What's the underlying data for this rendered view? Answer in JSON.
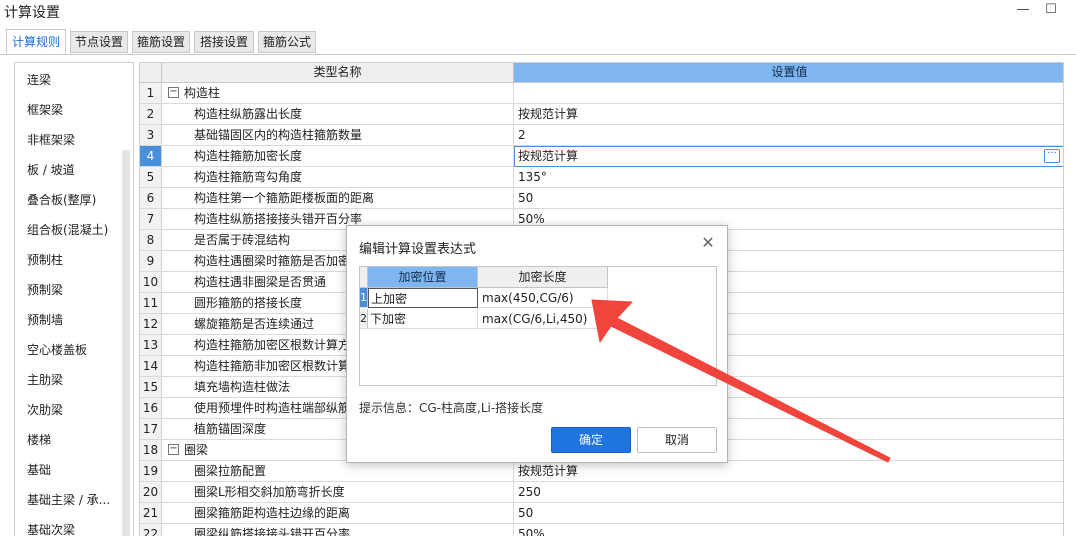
{
  "window": {
    "title": "计算设置",
    "minimize": "—",
    "maximize": "☐"
  },
  "tabs": [
    "计算规则",
    "节点设置",
    "箍筋设置",
    "搭接设置",
    "箍筋公式"
  ],
  "sidebar": {
    "items": [
      "连梁",
      "框架梁",
      "非框架梁",
      "板 / 坡道",
      "叠合板(整厚)",
      "组合板(混凝土)",
      "预制柱",
      "预制梁",
      "预制墙",
      "空心楼盖板",
      "主肋梁",
      "次肋梁",
      "楼梯",
      "基础",
      "基础主梁 / 承...",
      "基础次梁"
    ]
  },
  "grid": {
    "header_name": "类型名称",
    "header_value": "设置值",
    "expander_symbol": "−",
    "ellipsis": "···",
    "rows": [
      {
        "num": "1",
        "name": "构造柱",
        "value": "",
        "group": true
      },
      {
        "num": "2",
        "name": "构造柱纵筋露出长度",
        "value": "按规范计算"
      },
      {
        "num": "3",
        "name": "基础锚固区内的构造柱箍筋数量",
        "value": "2"
      },
      {
        "num": "4",
        "name": "构造柱箍筋加密长度",
        "value": "按规范计算",
        "selected": true
      },
      {
        "num": "5",
        "name": "构造柱箍筋弯勾角度",
        "value": "135°"
      },
      {
        "num": "6",
        "name": "构造柱第一个箍筋距楼板面的距离",
        "value": "50"
      },
      {
        "num": "7",
        "name": "构造柱纵筋搭接接头错开百分率",
        "value": "50%"
      },
      {
        "num": "8",
        "name": "是否属于砖混结构",
        "value": ""
      },
      {
        "num": "9",
        "name": "构造柱遇圈梁时箍筋是否加密",
        "value": ""
      },
      {
        "num": "10",
        "name": "构造柱遇非圈梁是否贯通",
        "value": ""
      },
      {
        "num": "11",
        "name": "圆形箍筋的搭接长度",
        "value": ""
      },
      {
        "num": "12",
        "name": "螺旋箍筋是否连续通过",
        "value": ""
      },
      {
        "num": "13",
        "name": "构造柱箍筋加密区根数计算方",
        "value": ""
      },
      {
        "num": "14",
        "name": "构造柱箍筋非加密区根数计算",
        "value": ""
      },
      {
        "num": "15",
        "name": "填充墙构造柱做法",
        "value": ""
      },
      {
        "num": "16",
        "name": "使用预埋件时构造柱端部纵筋",
        "value": ""
      },
      {
        "num": "17",
        "name": "植筋锚固深度",
        "value": ""
      },
      {
        "num": "18",
        "name": "圈梁",
        "value": "",
        "group": true
      },
      {
        "num": "19",
        "name": "圈梁拉筋配置",
        "value": "按规范计算"
      },
      {
        "num": "20",
        "name": "圈梁L形相交斜加筋弯折长度",
        "value": "250"
      },
      {
        "num": "21",
        "name": "圈梁箍筋距构造柱边缘的距离",
        "value": "50"
      },
      {
        "num": "22",
        "name": "圈梁纵筋搭接接头错开百分率",
        "value": "50%"
      }
    ]
  },
  "dialog": {
    "title": "编辑计算设置表达式",
    "close": "✕",
    "col_position": "加密位置",
    "col_length": "加密长度",
    "rows": [
      {
        "num": "1",
        "position": "上加密",
        "length": "max(450,CG/6)"
      },
      {
        "num": "2",
        "position": "下加密",
        "length": "max(CG/6,Li,450)"
      }
    ],
    "hint": "提示信息：CG-柱高度,Li-搭接长度",
    "ok": "确定",
    "cancel": "取消"
  },
  "colors": {
    "accent": "#1f74e0",
    "header_blue": "#7fb6ef",
    "arrow": "#f0453c"
  }
}
